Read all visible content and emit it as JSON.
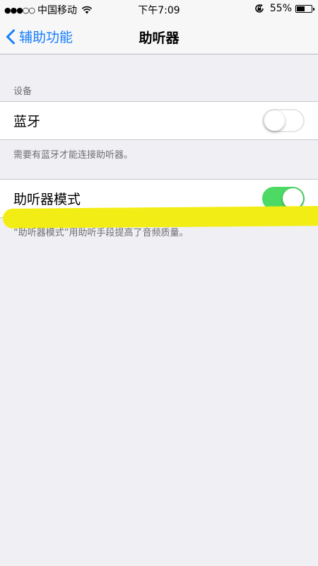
{
  "status_bar": {
    "signal": "●●●○○",
    "carrier": "中国移动",
    "time": "下午7:09",
    "battery_percent_text": "55%",
    "battery_level": 0.55,
    "icons": [
      "wifi-icon",
      "rotation-lock-icon",
      "battery-icon"
    ]
  },
  "nav": {
    "back_label": "辅助功能",
    "title": "助听器"
  },
  "section": {
    "header": "设备"
  },
  "bluetooth_row": {
    "label": "蓝牙",
    "switch_state": "off",
    "footer": "需要有蓝牙才能连接助听器。"
  },
  "hearing_aid_mode_row": {
    "label": "助听器模式",
    "switch_state": "on",
    "footer": "“助听器模式”用助听手段提高了音频质量。"
  },
  "colors": {
    "accent": "#157efb",
    "switch_on": "#4cd964",
    "background": "#efeff4",
    "highlight": "#f2ee15"
  }
}
